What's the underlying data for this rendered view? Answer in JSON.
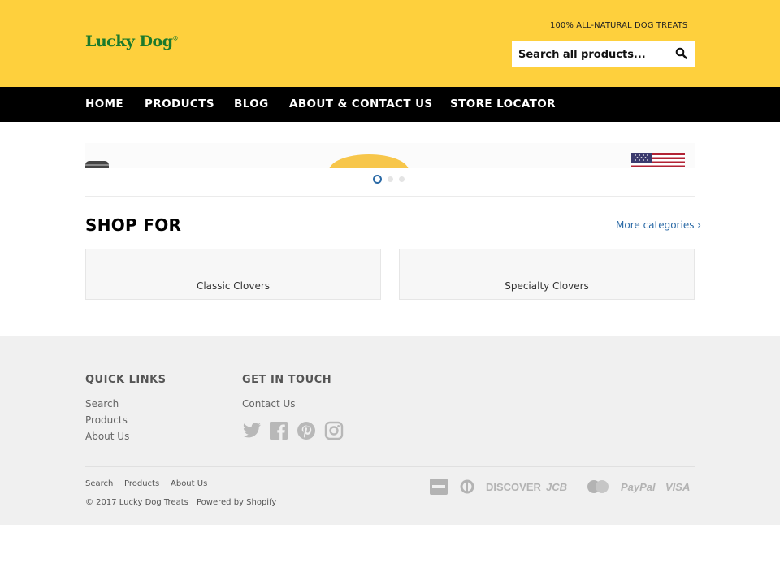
{
  "header": {
    "logo": "Lucky Dog",
    "logo_mark": "®",
    "tagline": "100% ALL-NATURAL DOG TREATS",
    "search_placeholder": "Search all products..."
  },
  "nav": {
    "items": [
      "HOME",
      "PRODUCTS",
      "BLOG",
      "ABOUT & CONTACT US",
      "STORE LOCATOR"
    ]
  },
  "hero": {
    "slides": 3,
    "active_slide": 1
  },
  "shop": {
    "title": "SHOP FOR",
    "more_link": "More categories ›",
    "categories": [
      "Classic Clovers",
      "Specialty Clovers"
    ]
  },
  "footer": {
    "quick_links": {
      "title": "QUICK LINKS",
      "links": [
        "Search",
        "Products",
        "About Us"
      ]
    },
    "get_in_touch": {
      "title": "GET IN TOUCH",
      "links": [
        "Contact Us"
      ],
      "social_icons": [
        "twitter-icon",
        "facebook-icon",
        "pinterest-icon",
        "instagram-icon"
      ]
    },
    "bottom_links": [
      "Search",
      "Products",
      "About Us"
    ],
    "copyright": "© 2017 Lucky Dog Treats",
    "powered_by": "Powered by Shopify",
    "payment_methods": [
      "American Express",
      "Diners Club",
      "DISCOVER",
      "JCB",
      "MasterCard",
      "PayPal",
      "VISA"
    ]
  },
  "colors": {
    "header_bg": "#fed03d",
    "nav_bg": "#000000",
    "logo": "#1c7a2c",
    "link": "#2b6aa6",
    "footer_bg": "#f0f0f0"
  }
}
